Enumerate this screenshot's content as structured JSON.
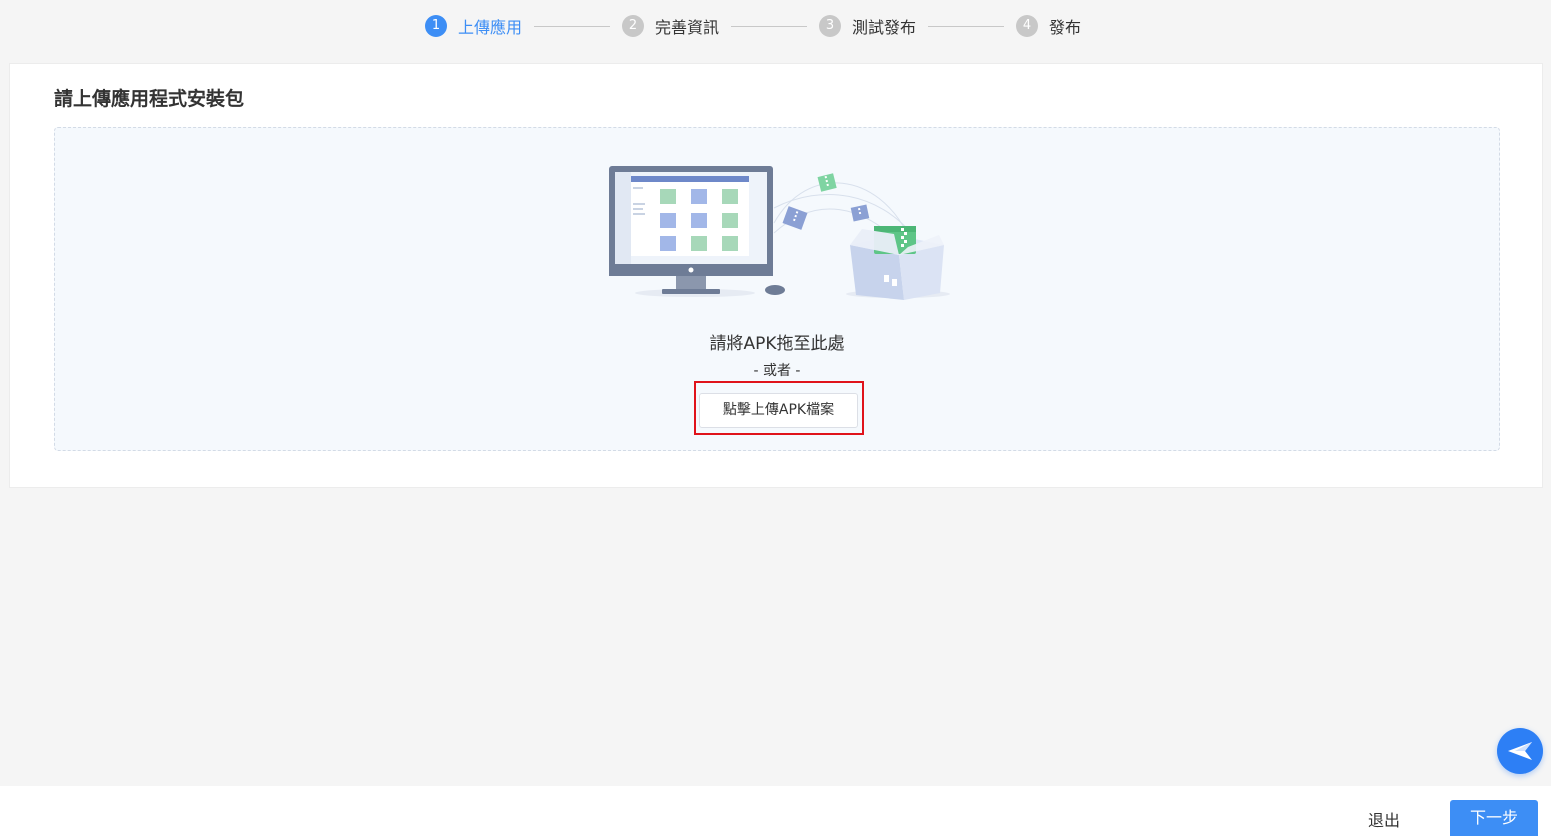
{
  "steps": [
    {
      "num": "1",
      "label": "上傳應用",
      "active": true
    },
    {
      "num": "2",
      "label": "完善資訊",
      "active": false
    },
    {
      "num": "3",
      "label": "測試發布",
      "active": false
    },
    {
      "num": "4",
      "label": "發布",
      "active": false
    }
  ],
  "card": {
    "title": "請上傳應用程式安裝包",
    "drop_text": "請將APK拖至此處",
    "or_text": "- 或者 -",
    "upload_button": "點擊上傳APK檔案"
  },
  "footer": {
    "exit_label": "退出",
    "next_label": "下一步"
  },
  "colors": {
    "accent": "#3d8ef5",
    "highlight": "#e0131b",
    "inactive_step": "#c8c8c8"
  },
  "icons": {
    "fab": "paper-plane-icon",
    "illustration": "computer-upload-box-illustration"
  }
}
